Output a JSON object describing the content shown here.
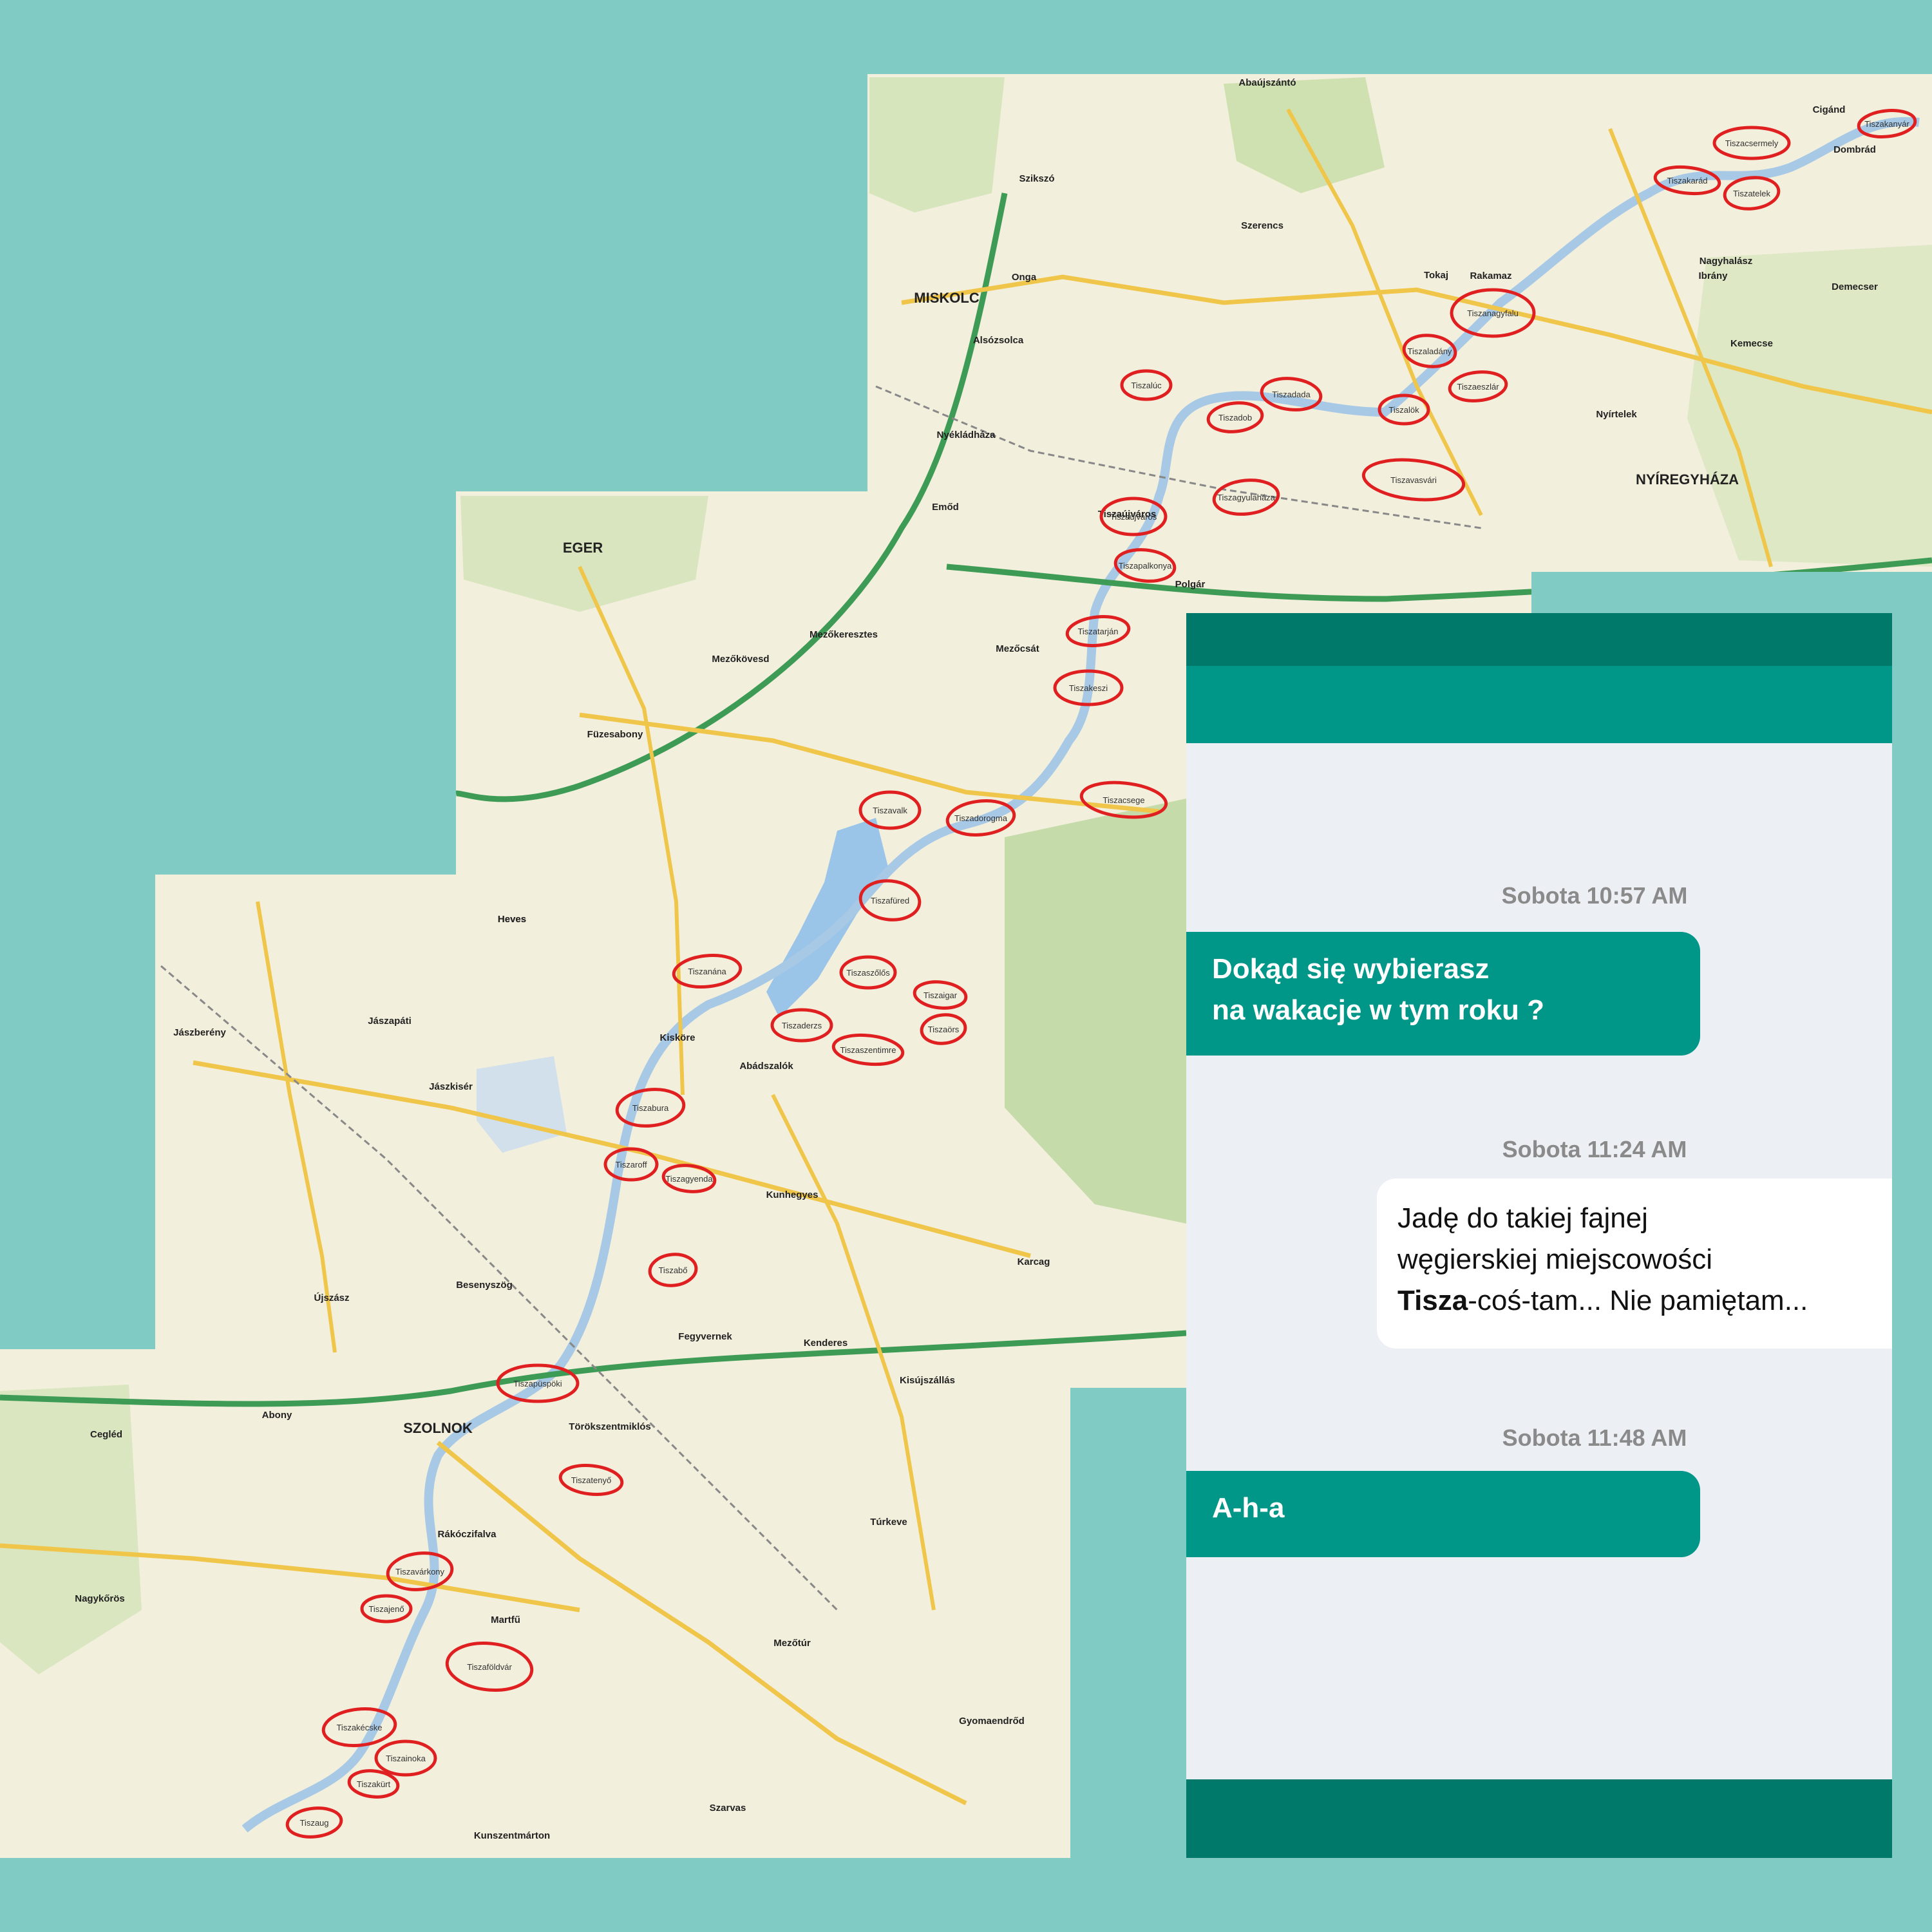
{
  "map": {
    "cities": [
      "MISKOLC",
      "EGER",
      "SZOLNOK",
      "NYÍREGYHÁZA",
      "Tokaj",
      "Rakamaz",
      "Mezőkövesd",
      "Füzesabony",
      "Heves",
      "Jászapáti",
      "Jászberény",
      "Abony",
      "Cegléd",
      "Nagykőrös",
      "Martfű",
      "Mezőtúr",
      "Kunhegyes",
      "Kisújszállás",
      "Karcag",
      "Polgár",
      "Tiszaújváros",
      "Szerencs",
      "Onga",
      "Szikszó",
      "Mezőcsát",
      "Kisköre",
      "Abádszalók",
      "Törökszentmiklós",
      "Rákóczifalva",
      "Szarvas",
      "Kunszentmárton",
      "Gyomaendrőd",
      "Túrkeve",
      "Kenderes",
      "Fegyvernek",
      "Besenyszög",
      "Újszász",
      "Jászkisér",
      "Cigánd",
      "Dombrád",
      "Ibrány",
      "Nagyhalász",
      "Kemecse",
      "Demecser",
      "Nyírtelek",
      "Emőd",
      "Nyékládháza",
      "Alsózsolca",
      "Mezőkeresztes",
      "Abaújszántó",
      "Heves"
    ],
    "circled_towns": [
      "Tiszakanyár",
      "Tiszacsermely",
      "Tiszakarád",
      "Tiszatelek",
      "Tiszanagyfalu",
      "Tiszaladány",
      "Tiszaeszlár",
      "Tiszalúc",
      "Tiszadada",
      "Tiszadob",
      "Tiszalök",
      "Tiszavasvári",
      "Tiszagyulaháza",
      "Tiszaújváros",
      "Tiszapalkonya",
      "Tiszatarján",
      "Tiszakeszi",
      "Tiszacsege",
      "Tiszadorogma",
      "Tiszavalk",
      "Tiszafüred",
      "Tiszanána",
      "Tiszaszőlős",
      "Tiszaigar",
      "Tiszaörs",
      "Tiszaderzs",
      "Tiszaszentimre",
      "Tiszabura",
      "Tiszaroff",
      "Tiszagyenda",
      "Tiszabő",
      "Tiszapüspöki",
      "Tiszatenyő",
      "Tiszavárkony",
      "Tiszajenő",
      "Tiszaföldvár",
      "Tiszakécske",
      "Tiszainoka",
      "Tiszakürt",
      "Tiszaug"
    ]
  },
  "chat": {
    "messages": [
      {
        "time": "Sobota 10:57 AM",
        "lines": [
          "Dokąd się wybierasz",
          "na wakacje w tym roku ?"
        ]
      },
      {
        "time": "Sobota 11:24 AM",
        "line1": "Jadę do takiej fajnej",
        "line2": "węgierskiej miejscowości",
        "bold": "Tisza",
        "rest": "-coś-tam... Nie pamiętam..."
      },
      {
        "time": "Sobota 11:48 AM",
        "lines": [
          "A-h-a"
        ]
      }
    ]
  }
}
